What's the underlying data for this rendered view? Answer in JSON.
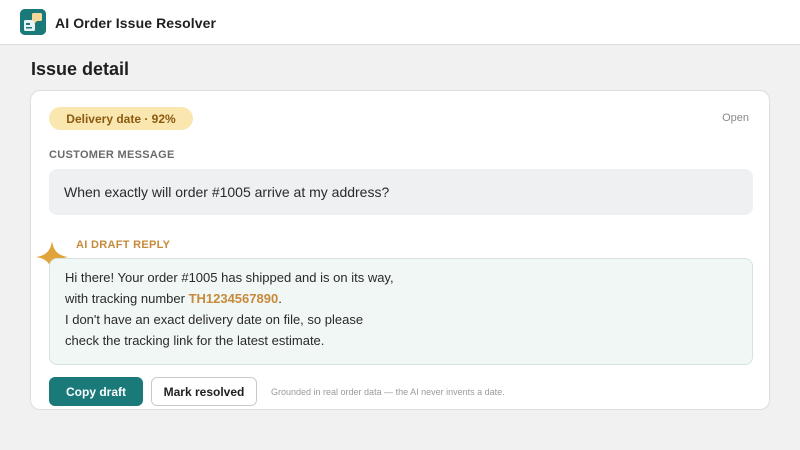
{
  "app": {
    "title": "AI Order Issue Resolver",
    "logo_icon": "puzzle-chat-icon",
    "accent_color": "#1a7a7a"
  },
  "page": {
    "title": "Issue detail"
  },
  "issue": {
    "badge": "Delivery date · 92%",
    "status": "Open",
    "customer_label": "CUSTOMER MESSAGE",
    "customer_message": "When exactly will order #1005 arrive at my address?",
    "ai_label": "AI DRAFT REPLY",
    "ai_icon": "sparkle-icon",
    "draft": {
      "line1": "Hi there! Your order #1005 has shipped and is on its way,",
      "line2_prefix": "with tracking number ",
      "tracking_number": "TH1234567890",
      "line2_suffix": ".",
      "line3": "I don't have an exact delivery date on file, so please",
      "line4": "check the tracking link for the latest estimate."
    }
  },
  "actions": {
    "copy_label": "Copy draft",
    "resolve_label": "Mark resolved",
    "footnote": "Grounded in real order data — the AI never invents a date."
  }
}
